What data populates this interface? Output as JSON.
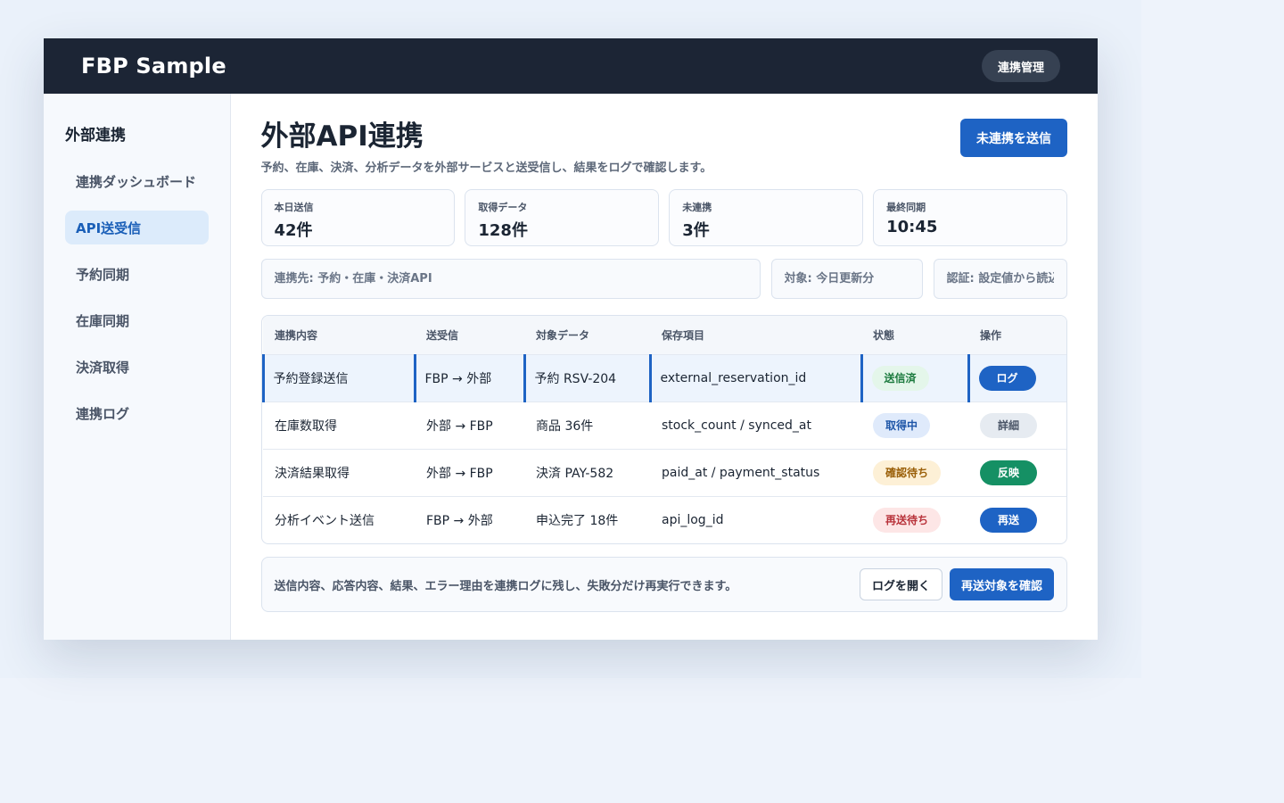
{
  "app": {
    "brand": "FBP Sample",
    "top_button": "連携管理"
  },
  "sidebar": {
    "title": "外部連携",
    "items": [
      {
        "label": "連携ダッシュボード",
        "active": false
      },
      {
        "label": "API送受信",
        "active": true
      },
      {
        "label": "予約同期",
        "active": false
      },
      {
        "label": "在庫同期",
        "active": false
      },
      {
        "label": "決済取得",
        "active": false
      },
      {
        "label": "連携ログ",
        "active": false
      }
    ]
  },
  "main": {
    "title": "外部API連携",
    "subtitle": "予約、在庫、決済、分析データを外部サービスと送受信し、結果をログで確認します。",
    "primary_button": "未連携を送信",
    "stats": [
      {
        "label": "本日送信",
        "value": "42件"
      },
      {
        "label": "取得データ",
        "value": "128件"
      },
      {
        "label": "未連携",
        "value": "3件"
      },
      {
        "label": "最終同期",
        "value": "10:45"
      }
    ],
    "filters": {
      "target_api": "連携先: 予約・在庫・決済API",
      "scope": "対象: 今日更新分",
      "auth": "認証: 設定値から読込"
    }
  },
  "table": {
    "headers": [
      "連携内容",
      "送受信",
      "対象データ",
      "保存項目",
      "状態",
      "操作"
    ],
    "rows": [
      {
        "content": "予約登録送信",
        "direction": "FBP → 外部",
        "target": "予約 RSV-204",
        "field": "external_reservation_id",
        "status": "送信済",
        "action": "ログ"
      },
      {
        "content": "在庫数取得",
        "direction": "外部 → FBP",
        "target": "商品 36件",
        "field": "stock_count / synced_at",
        "status": "取得中",
        "action": "詳細"
      },
      {
        "content": "決済結果取得",
        "direction": "外部 → FBP",
        "target": "決済 PAY-582",
        "field": "paid_at / payment_status",
        "status": "確認待ち",
        "action": "反映"
      },
      {
        "content": "分析イベント送信",
        "direction": "FBP → 外部",
        "target": "申込完了 18件",
        "field": "api_log_id",
        "status": "再送待ち",
        "action": "再送"
      }
    ]
  },
  "footer": {
    "text": "送信内容、応答内容、結果、エラー理由を連携ログに残し、失敗分だけ再実行できます。",
    "open_log": "ログを開く",
    "check_resend": "再送対象を確認"
  },
  "colors": {
    "topbar": "#1c2535",
    "accent": "#1e63c4",
    "sidebar_active_bg": "#dcebfb",
    "status_sent": "#1b7a3d",
    "status_fetching": "#1e56a8",
    "status_pending": "#9a5f08",
    "status_retry": "#b8323a"
  }
}
